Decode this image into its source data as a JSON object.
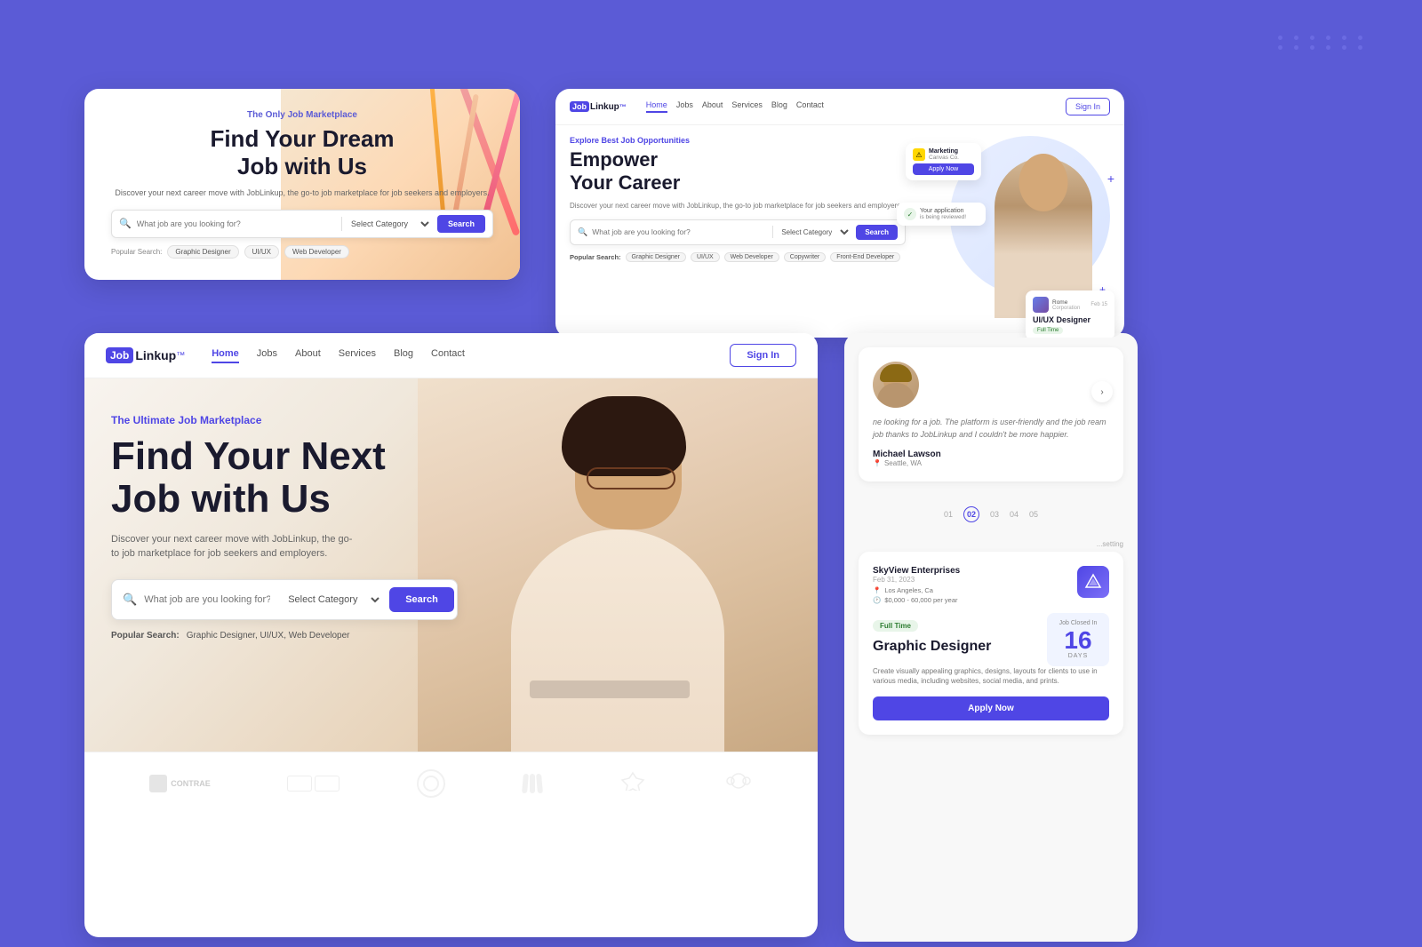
{
  "app": {
    "brand": "JobLinkup",
    "brand_job": "Job",
    "brand_link": "Linkup",
    "trademark": "™"
  },
  "card1": {
    "tagline": "The Only Job Marketplace",
    "title_line1": "Find Your Dream",
    "title_line2": "Job with Us",
    "description": "Discover your next career move with JobLinkup, the go-to job marketplace for job seekers and employers.",
    "search_placeholder": "What job are you looking for?",
    "category_placeholder": "Select Category",
    "search_btn": "Search",
    "popular_label": "Popular Search:",
    "popular_tags": [
      "Graphic Designer",
      "UI/UX",
      "Web Developer"
    ]
  },
  "card2": {
    "nav": {
      "home": "Home",
      "jobs": "Jobs",
      "about": "About",
      "services": "Services",
      "blog": "Blog",
      "contact": "Contact",
      "signin": "Sign In"
    },
    "tagline": "Explore Best Job Opportunities",
    "title_line1": "Empower",
    "title_line2": "Your Career",
    "description": "Discover your next career move with JobLinkup, the go-to job marketplace for job seekers and employers.",
    "search_placeholder": "What job are you looking for?",
    "category_placeholder": "Select Category",
    "search_btn": "Search",
    "popular_label": "Popular Search:",
    "popular_tags": [
      "Graphic Designer",
      "UI/UX",
      "Web Developer",
      "Copywriter",
      "Front-End Developer"
    ],
    "floating_card1_label": "Marketing",
    "floating_card1_sub": "Canvas Co.",
    "floating_card1_btn": "Apply Now",
    "floating_card2_label": "Your application",
    "floating_card2_sub": "is being reviewed!",
    "floating_job_company": "Rome",
    "floating_job_company_sub": "Corporation",
    "floating_job_title": "UI/UX Designer",
    "floating_job_badge": "Full Time",
    "floating_job_date": "Feb 15"
  },
  "card3": {
    "nav": {
      "home": "Home",
      "jobs": "Jobs",
      "about": "About",
      "services": "Services",
      "blog": "Blog",
      "contact": "Contact",
      "signin": "Sign In"
    },
    "tagline": "The Ultimate Job Marketplace",
    "title_line1": "Find Your Next",
    "title_line2": "Job with Us",
    "description": "Discover your next career move with JobLinkup, the go-to job marketplace for job seekers and employers.",
    "search_placeholder": "What job are you looking for?",
    "category_placeholder": "Select Category",
    "search_btn": "Search",
    "popular_label": "Popular Search:",
    "popular_tags": "Graphic Designer, UI/UX, Web Developer",
    "companies": [
      "Contrae",
      "",
      "",
      "",
      "",
      ""
    ]
  },
  "card4": {
    "testimonial_text": "ne looking for a job. The platform is user-friendly and the job ream job thanks to JobLinkup and I couldn't be more happier.",
    "author_name": "Michael Lawson",
    "author_location": "Seattle, WA",
    "pagination": [
      "01",
      "02",
      "03",
      "04",
      "05"
    ],
    "active_page": "02",
    "job_company": "SkyView Enterprises",
    "job_date": "Feb 31, 2023",
    "job_location": "Los Angeles, Ca",
    "job_salary": "$0,000 - 60,000 per year",
    "job_title": "Graphic Designer",
    "job_badge": "Full Time",
    "job_closed_label": "Job Closed In",
    "job_days_num": "16",
    "job_days_label": "DAYS",
    "job_desc": "Create visually appealing graphics, designs, layouts for clients to use in various media, including websites, social media, and prints.",
    "apply_btn": "Apply Now",
    "countdown_label": "Job Closed In"
  },
  "icons": {
    "search": "🔍",
    "chevron_down": "▾",
    "chevron_right": "›",
    "location": "📍",
    "clock": "🕐",
    "check": "✓",
    "warning": "⚠",
    "star": "★",
    "dot": "•"
  }
}
